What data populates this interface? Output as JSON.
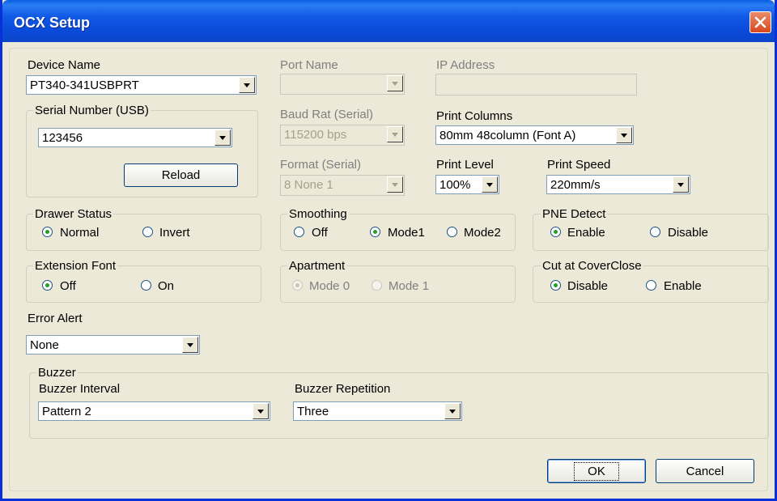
{
  "window": {
    "title": "OCX Setup"
  },
  "device": {
    "label": "Device Name",
    "value": "PT340-341USBPRT"
  },
  "serial_group": {
    "title": "Serial Number  (USB)",
    "value": "123456",
    "reload_label": "Reload"
  },
  "port": {
    "label": "Port Name",
    "value": ""
  },
  "ip": {
    "label": "IP Address",
    "value": ""
  },
  "baud": {
    "label": "Baud Rat  (Serial)",
    "value": "115200 bps"
  },
  "print_columns": {
    "label": "Print Columns",
    "value": "80mm 48column (Font A)"
  },
  "format": {
    "label": "Format  (Serial)",
    "value": "8 None 1"
  },
  "print_level": {
    "label": "Print Level",
    "value": "100%"
  },
  "print_speed": {
    "label": "Print Speed",
    "value": "220mm/s"
  },
  "drawer": {
    "title": "Drawer Status",
    "options": [
      "Normal",
      "Invert"
    ],
    "selected": "Normal"
  },
  "smoothing": {
    "title": "Smoothing",
    "options": [
      "Off",
      "Mode1",
      "Mode2"
    ],
    "selected": "Mode1"
  },
  "pne": {
    "title": "PNE Detect",
    "options": [
      "Enable",
      "Disable"
    ],
    "selected": "Enable"
  },
  "ext_font": {
    "title": "Extension Font",
    "options": [
      "Off",
      "On"
    ],
    "selected": "Off"
  },
  "apartment": {
    "title": "Apartment",
    "options": [
      "Mode 0",
      "Mode 1"
    ],
    "selected": "Mode 0"
  },
  "cut": {
    "title": "Cut at CoverClose",
    "options": [
      "Disable",
      "Enable"
    ],
    "selected": "Disable"
  },
  "error_alert": {
    "label": "Error Alert",
    "value": "None"
  },
  "buzzer": {
    "title": "Buzzer",
    "interval_label": "Buzzer Interval",
    "interval_value": "Pattern 2",
    "repetition_label": "Buzzer Repetition",
    "repetition_value": "Three"
  },
  "buttons": {
    "ok": "OK",
    "cancel": "Cancel"
  },
  "colors": {
    "title_bar": "#0a4ad8",
    "dialog_bg": "#ece9d8",
    "radio_dot": "#21a121"
  }
}
